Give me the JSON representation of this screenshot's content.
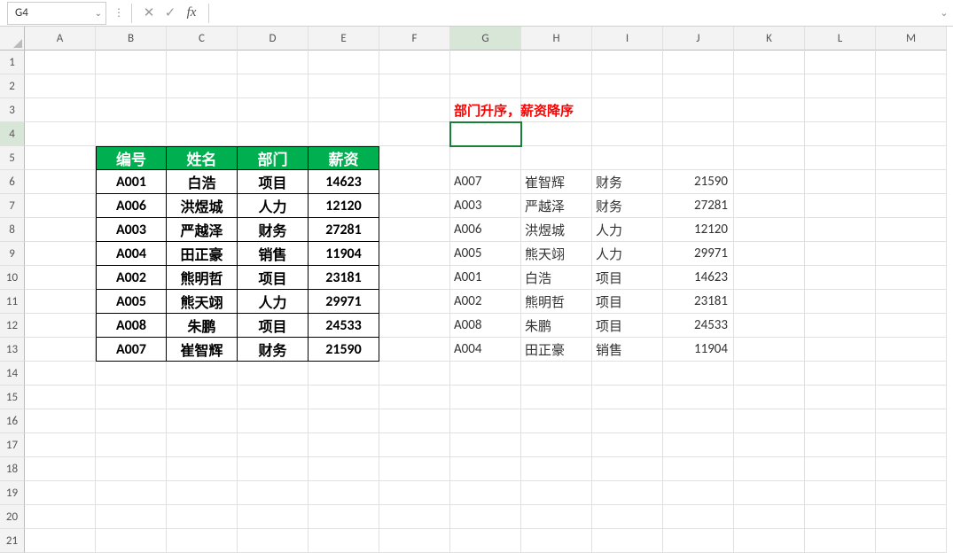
{
  "name_box": "G4",
  "formula_input": "",
  "columns": [
    "A",
    "B",
    "C",
    "D",
    "E",
    "F",
    "G",
    "H",
    "I",
    "J",
    "K",
    "L",
    "M"
  ],
  "row_count": 21,
  "active": {
    "col": "G",
    "row": 4
  },
  "title_text": "部门升序，薪资降序",
  "table_headers": [
    "编号",
    "姓名",
    "部门",
    "薪资"
  ],
  "table_rows": [
    [
      "A001",
      "白浩",
      "项目",
      "14623"
    ],
    [
      "A006",
      "洪煜城",
      "人力",
      "12120"
    ],
    [
      "A003",
      "严越泽",
      "财务",
      "27281"
    ],
    [
      "A004",
      "田正豪",
      "销售",
      "11904"
    ],
    [
      "A002",
      "熊明哲",
      "项目",
      "23181"
    ],
    [
      "A005",
      "熊天翊",
      "人力",
      "29971"
    ],
    [
      "A008",
      "朱鹏",
      "项目",
      "24533"
    ],
    [
      "A007",
      "崔智辉",
      "财务",
      "21590"
    ]
  ],
  "sorted_rows": [
    [
      "A007",
      "崔智辉",
      "财务",
      "21590"
    ],
    [
      "A003",
      "严越泽",
      "财务",
      "27281"
    ],
    [
      "A006",
      "洪煜城",
      "人力",
      "12120"
    ],
    [
      "A005",
      "熊天翊",
      "人力",
      "29971"
    ],
    [
      "A001",
      "白浩",
      "项目",
      "14623"
    ],
    [
      "A002",
      "熊明哲",
      "项目",
      "23181"
    ],
    [
      "A008",
      "朱鹏",
      "项目",
      "24533"
    ],
    [
      "A004",
      "田正豪",
      "销售",
      "11904"
    ]
  ],
  "icons": {
    "cancel": "✕",
    "accept": "✓",
    "fx": "fx",
    "chevron": "⌄",
    "vdots": "⋮"
  }
}
